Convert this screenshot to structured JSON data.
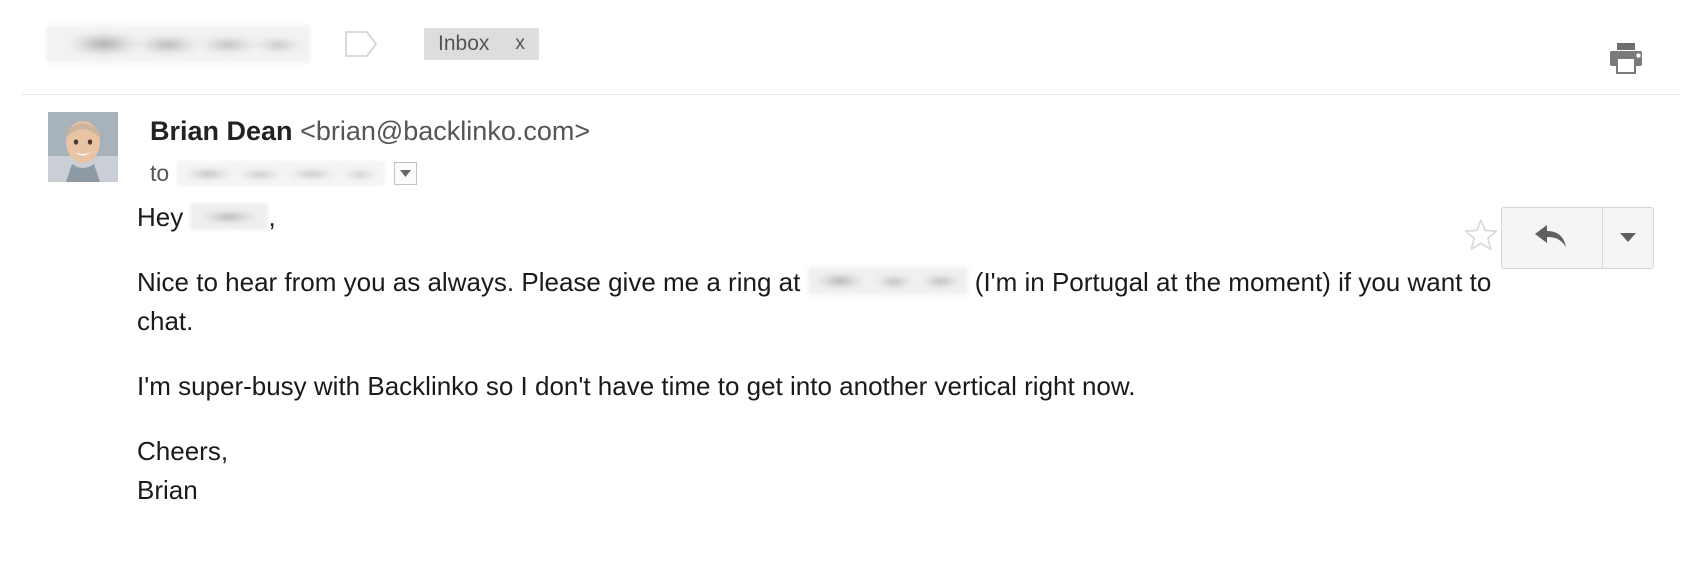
{
  "header": {
    "subject_redacted": true,
    "label_icon": "label-tag-icon",
    "inbox_chip": {
      "label": "Inbox",
      "close": "x"
    },
    "print_icon": "print-icon"
  },
  "message": {
    "avatar_alt": "sender-avatar",
    "sender_name": "Brian Dean",
    "sender_email": "<brian@backlinko.com>",
    "to_label": "to",
    "to_redacted": true,
    "to_caret_icon": "chevron-down-icon",
    "star_icon": "star-outline-icon",
    "reply_icon": "reply-arrow-icon",
    "more_icon": "chevron-down-icon"
  },
  "body": {
    "greeting_prefix": "Hey",
    "greeting_suffix": ",",
    "paragraph_2_before": "Nice to hear from you as always. Please give me a ring at",
    "paragraph_2_after": "(I'm in Portugal at the moment) if you want to chat.",
    "paragraph_3": "I'm super-busy with Backlinko so I don't have time to get into another vertical right now.",
    "signoff": "Cheers,",
    "signature": "Brian"
  },
  "colors": {
    "chip_bg": "#dddddd",
    "chip_text": "#555555",
    "body_text": "#1a1a1a",
    "icon_gray": "#777777",
    "button_bg": "#f5f5f5",
    "button_border": "#d6d6d6",
    "rule": "#e6e6e6"
  }
}
